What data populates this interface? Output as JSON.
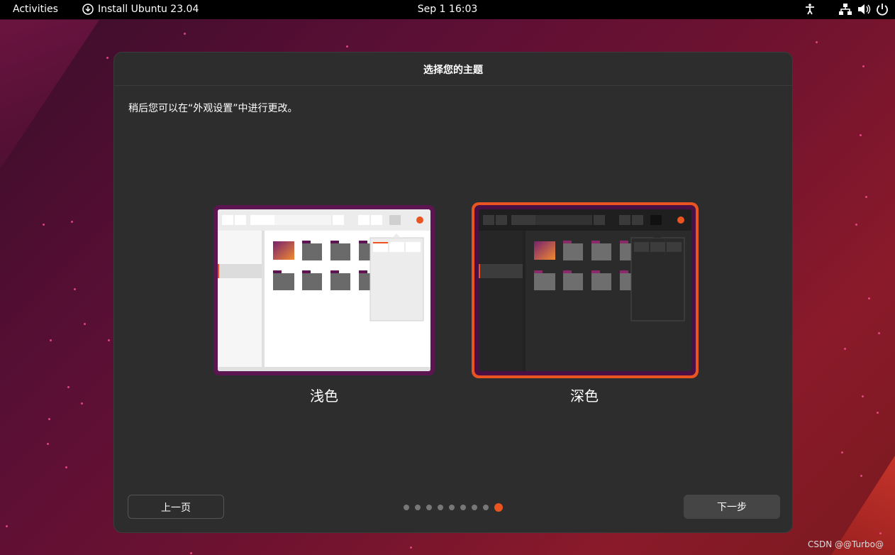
{
  "topbar": {
    "activities": "Activities",
    "app_name": "Install Ubuntu 23.04",
    "clock": "Sep 1  16:03",
    "tray_icons": [
      "accessibility-icon",
      "network-icon",
      "volume-icon",
      "power-icon"
    ]
  },
  "dialog": {
    "title": "选择您的主题",
    "subtitle": "稍后您可以在“外观设置”中进行更改。",
    "themes": [
      {
        "label": "浅色",
        "selected": false
      },
      {
        "label": "深色",
        "selected": true
      }
    ],
    "back_label": "上一页",
    "next_label": "下一步",
    "pagination": {
      "total": 9,
      "current": 9
    }
  },
  "colors": {
    "accent": "#e95420",
    "dialog_bg": "#2d2d2d",
    "topbar_bg": "#000000"
  },
  "watermark": "CSDN @@Turbo@"
}
